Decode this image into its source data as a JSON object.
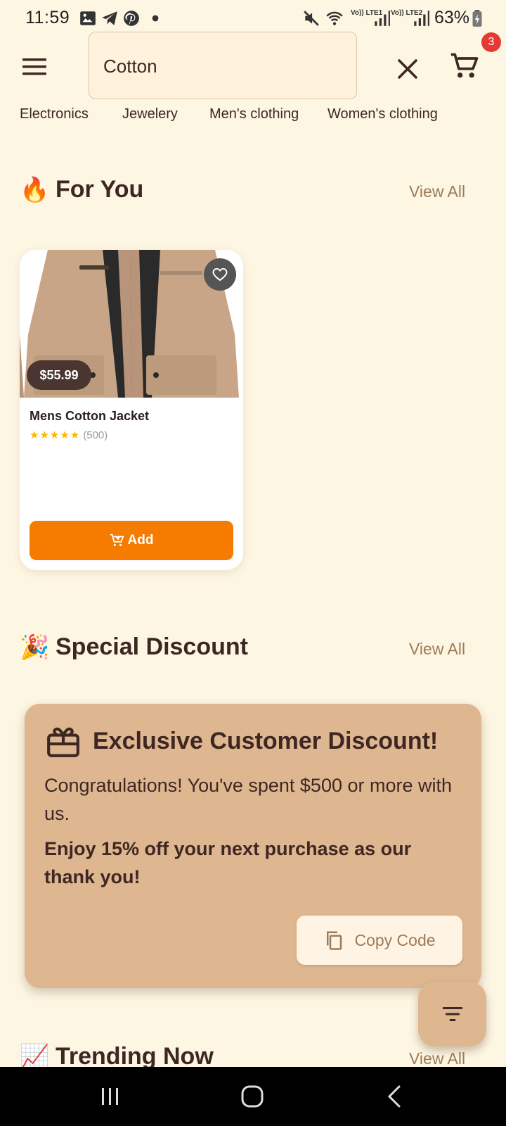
{
  "status_bar": {
    "time": "11:59",
    "battery": "63%",
    "network_1": "Vo)) LTE1",
    "network_2": "Vo)) LTE2"
  },
  "header": {
    "search_value": "Cotton",
    "cart_count": "3"
  },
  "categories": [
    "Electronics",
    "Jewelery",
    "Men's clothing",
    "Women's clothing"
  ],
  "for_you": {
    "emoji": "🔥",
    "title": "For You",
    "view_all": "View All"
  },
  "product": {
    "name": "Mens Cotton Jacket",
    "price": "$55.99",
    "stars": "★★★★★",
    "rating": 5,
    "review_count": "(500)",
    "add_label": "Add"
  },
  "special_discount": {
    "emoji": "🎉",
    "title": "Special Discount",
    "view_all": "View All"
  },
  "discount_card": {
    "title": "Exclusive Customer Discount!",
    "message": "Congratulations! You've spent $500 or more with us.",
    "offer": "Enjoy 15% off your next purchase as our thank you!",
    "copy_label": "Copy Code"
  },
  "trending": {
    "emoji": "📈",
    "title": "Trending Now",
    "view_all": "View All"
  },
  "colors": {
    "background": "#FDF6E3",
    "accent": "#F57C00",
    "discount_card": "#DEB791",
    "text": "#3E2723",
    "muted": "#9E7B58",
    "badge": "#E53935"
  }
}
